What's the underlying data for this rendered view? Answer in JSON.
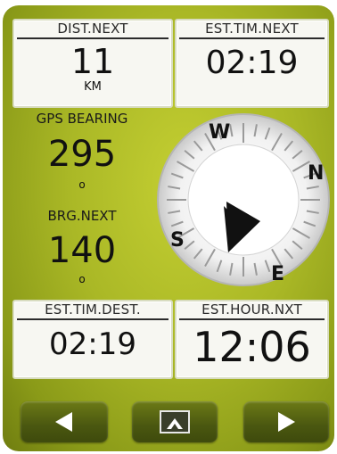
{
  "top_left": {
    "header": "DIST.NEXT",
    "value": "11",
    "unit": "KM"
  },
  "top_right": {
    "header": "EST.TIM.NEXT",
    "value": "02:19"
  },
  "gps_bearing": {
    "label": "GPS BEARING",
    "value": "295",
    "unit": "o"
  },
  "brg_next": {
    "label": "BRG.NEXT",
    "value": "140",
    "unit": "o"
  },
  "compass": {
    "letters": {
      "w": "W",
      "n": "N",
      "s": "S",
      "e": "E"
    }
  },
  "bottom_left": {
    "header": "EST.TIM.DEST.",
    "value": "02:19"
  },
  "bottom_right": {
    "header": "EST.HOUR.NXT",
    "value": "12:06"
  },
  "nav": {
    "prev_icon": "triangle-left-icon",
    "map_icon": "map-view-icon",
    "next_icon": "triangle-right-icon"
  },
  "colors": {
    "panel": "#aab826",
    "button": "#4a5710"
  }
}
